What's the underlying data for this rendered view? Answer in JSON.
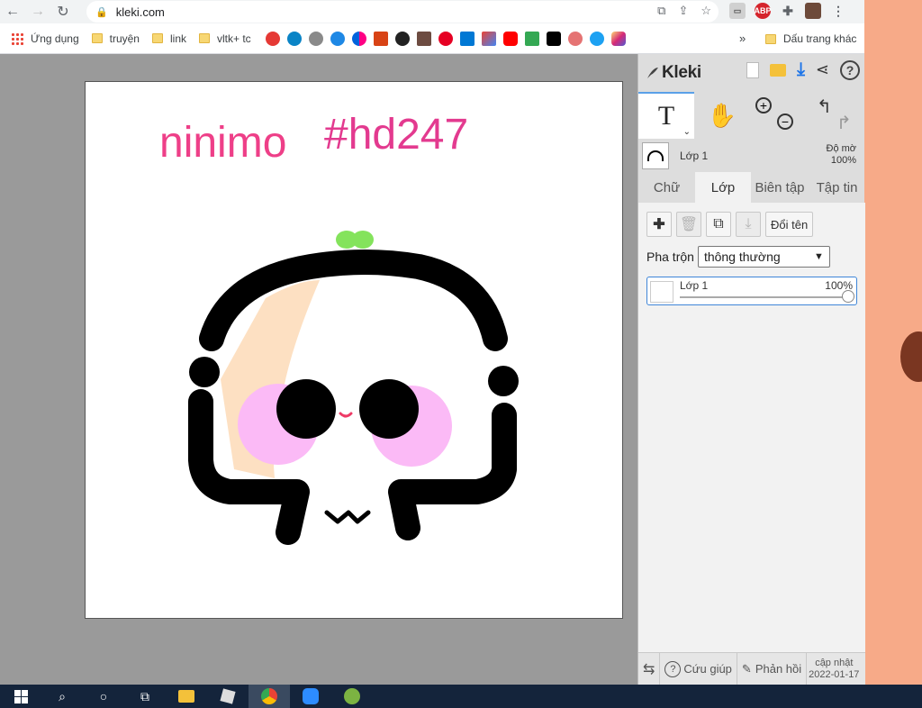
{
  "browser": {
    "url": "kleki.com",
    "bookmarks": [
      {
        "label": "Ứng dụng",
        "type": "apps"
      },
      {
        "label": "truyện",
        "type": "folder"
      },
      {
        "label": "link",
        "type": "folder"
      },
      {
        "label": "vltk+ tc",
        "type": "folder"
      }
    ],
    "more_label": "»",
    "other_bookmarks_label": "Dấu trang khác",
    "abp_label": "ABP"
  },
  "app": {
    "logo_text": "Kleki",
    "layer_preview_name": "Lớp 1",
    "opacity_label": "Độ mờ",
    "opacity_value": "100%",
    "tabs": [
      {
        "label": "Chữ",
        "active": false
      },
      {
        "label": "Lớp",
        "active": true
      },
      {
        "label": "Biên tập",
        "active": false
      },
      {
        "label": "Tập tin",
        "active": false
      }
    ],
    "rename_button": "Đổi tên",
    "blend_label": "Pha trộn",
    "blend_value": "thông thường",
    "layers": [
      {
        "name": "Lớp 1",
        "opacity": "100%",
        "opacity_fraction": 1.0
      }
    ],
    "footer": {
      "help_label": "Cứu giúp",
      "feedback_label": "Phản hồi",
      "update_label": "cập nhật",
      "update_date": "2022-01-17"
    }
  },
  "canvas": {
    "text_left": "ninimo",
    "text_right": "#hd247"
  },
  "colors": {
    "accent_blue": "#3f86d8",
    "text_pink": "#ee3f88",
    "canvas_bg": "#ffffff",
    "workspace_bg": "#9a9a9a"
  }
}
